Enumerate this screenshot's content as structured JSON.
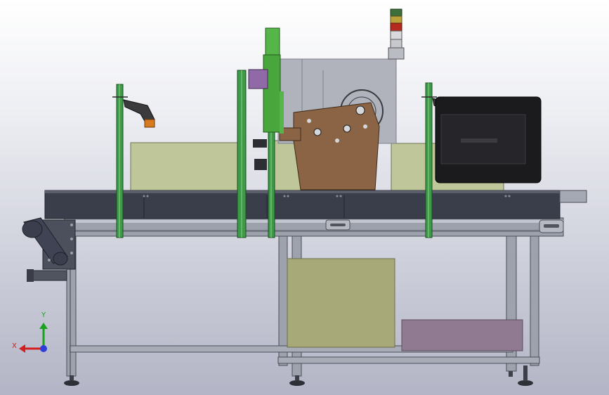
{
  "colors": {
    "frame_steel": "#8f939e",
    "frame_dark": "#4c505a",
    "conveyor_belt": "#3a3d4a",
    "box_green": "#bfc69a",
    "box_tan": "#a7aa78",
    "box_purple": "#8f7a92",
    "post_green": "#3d9a46",
    "scanner_orange": "#d87a1e",
    "bracket_brown": "#8a6444",
    "monitor_black": "#1b1b1e",
    "light_red": "#b52a1e",
    "light_yellow": "#b9a23a",
    "light_green": "#3d6f3a",
    "axis_x": "#d22020",
    "axis_y": "#19a21e",
    "axis_z": "#2d3fd8"
  },
  "triad": {
    "x_label": "X",
    "y_label": "Y"
  },
  "icons": [
    "axis-triad-icon",
    "barcode-scanner-icon",
    "stack-light-icon"
  ]
}
